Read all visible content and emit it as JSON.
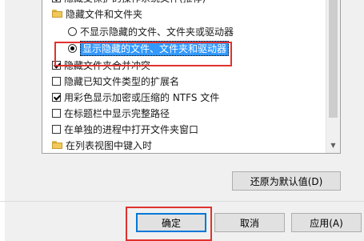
{
  "list": {
    "items": [
      {
        "type": "checkbox",
        "checked": true,
        "label": "隐藏受保护的操作系统文件(推荐)",
        "indent": 1
      },
      {
        "type": "folder",
        "label": "隐藏文件和文件夹",
        "indent": 1
      },
      {
        "type": "radio",
        "checked": false,
        "label": "不显示隐藏的文件、文件夹或驱动器",
        "indent": 2
      },
      {
        "type": "radio",
        "checked": true,
        "label": "显示隐藏的文件、文件夹和驱动器",
        "indent": 2
      },
      {
        "type": "checkbox",
        "checked": true,
        "label": "隐藏文件夹合并冲突",
        "indent": 1
      },
      {
        "type": "checkbox",
        "checked": false,
        "label": "隐藏已知文件类型的扩展名",
        "indent": 1
      },
      {
        "type": "checkbox",
        "checked": true,
        "label": "用彩色显示加密或压缩的 NTFS 文件",
        "indent": 1
      },
      {
        "type": "checkbox",
        "checked": false,
        "label": "在标题栏中显示完整路径",
        "indent": 1
      },
      {
        "type": "checkbox",
        "checked": false,
        "label": "在单独的进程中打开文件夹窗口",
        "indent": 1
      },
      {
        "type": "folder",
        "label": "在列表视图中键入时",
        "indent": 1
      }
    ]
  },
  "buttons": {
    "restore_defaults": "还原为默认值(D)",
    "ok": "确定",
    "cancel": "取消",
    "apply": "应用(A)"
  },
  "icons": {
    "scroll_down": "▼"
  },
  "colors": {
    "highlight_border": "#e0322e",
    "selection": "#3399ff"
  }
}
